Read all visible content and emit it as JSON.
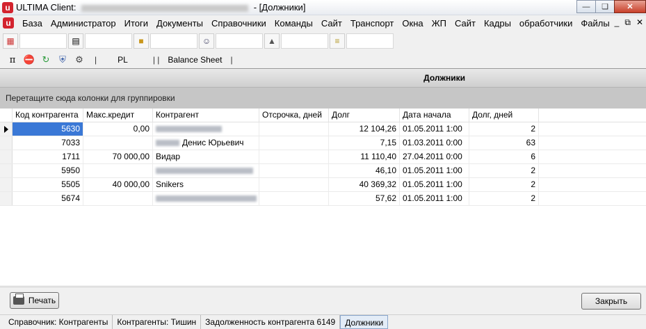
{
  "window": {
    "title_prefix": "ULTIMA Client:",
    "title_suffix": "- [Должники]"
  },
  "menu": {
    "items": [
      "База",
      "Администратор",
      "Итоги",
      "Документы",
      "Справочники",
      "Команды",
      "Сайт",
      "Транспорт",
      "Окна",
      "ЖП",
      "Сайт",
      "Кадры",
      "обработчики",
      "Файлы"
    ]
  },
  "toolbar2": {
    "pl_label": "PL",
    "balance_label": "Balance Sheet"
  },
  "panel": {
    "caption": "Должники",
    "group_hint": "Перетащите сюда колонки для группировки"
  },
  "grid": {
    "columns": [
      "Код контрагента",
      "Макс.кредит",
      "Контрагент",
      "Отсрочка, дней",
      "Долг",
      "Дата начала",
      "Долг, дней"
    ],
    "rows": [
      {
        "code": "5630",
        "credit": "0,00",
        "contr": "",
        "delay": "",
        "debt": "12 104,26",
        "date": "01.05.2011 1:00",
        "days": "2"
      },
      {
        "code": "7033",
        "credit": "",
        "contr": "Денис Юрьевич",
        "delay": "",
        "debt": "7,15",
        "date": "01.03.2011 0:00",
        "days": "63"
      },
      {
        "code": "1711",
        "credit": "70 000,00",
        "contr": "Видар",
        "delay": "",
        "debt": "11 110,40",
        "date": "27.04.2011 0:00",
        "days": "6"
      },
      {
        "code": "5950",
        "credit": "",
        "contr": "",
        "delay": "",
        "debt": "46,10",
        "date": "01.05.2011 1:00",
        "days": "2"
      },
      {
        "code": "5505",
        "credit": "40 000,00",
        "contr": "Snikers",
        "delay": "",
        "debt": "40 369,32",
        "date": "01.05.2011 1:00",
        "days": "2"
      },
      {
        "code": "5674",
        "credit": "",
        "contr": "",
        "delay": "",
        "debt": "57,62",
        "date": "01.05.2011 1:00",
        "days": "2"
      }
    ]
  },
  "buttons": {
    "print": "Печать",
    "close": "Закрыть"
  },
  "tabs": [
    "Справочник: Контрагенты",
    "Контрагенты: Тишин",
    "Задолженность контрагента 6149",
    "Должники"
  ]
}
